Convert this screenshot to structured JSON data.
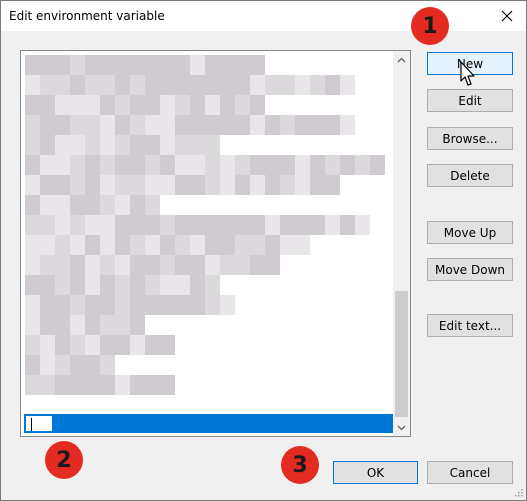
{
  "window": {
    "title": "Edit environment variable",
    "close_glyph": "✕"
  },
  "buttons": {
    "new": "New",
    "edit": "Edit",
    "browse": "Browse...",
    "delete": "Delete",
    "move_up": "Move Up",
    "move_down": "Move Down",
    "edit_text": "Edit text...",
    "ok": "OK",
    "cancel": "Cancel"
  },
  "annotations": {
    "step1": "1",
    "step2": "2",
    "step3": "3"
  },
  "colors": {
    "accent": "#0078d7",
    "badge": "#e32b22",
    "blur_light": "#e8e6e8",
    "blur_dark": "#cfcbd0"
  },
  "list": {
    "blurred_entries_count_visible": true
  }
}
